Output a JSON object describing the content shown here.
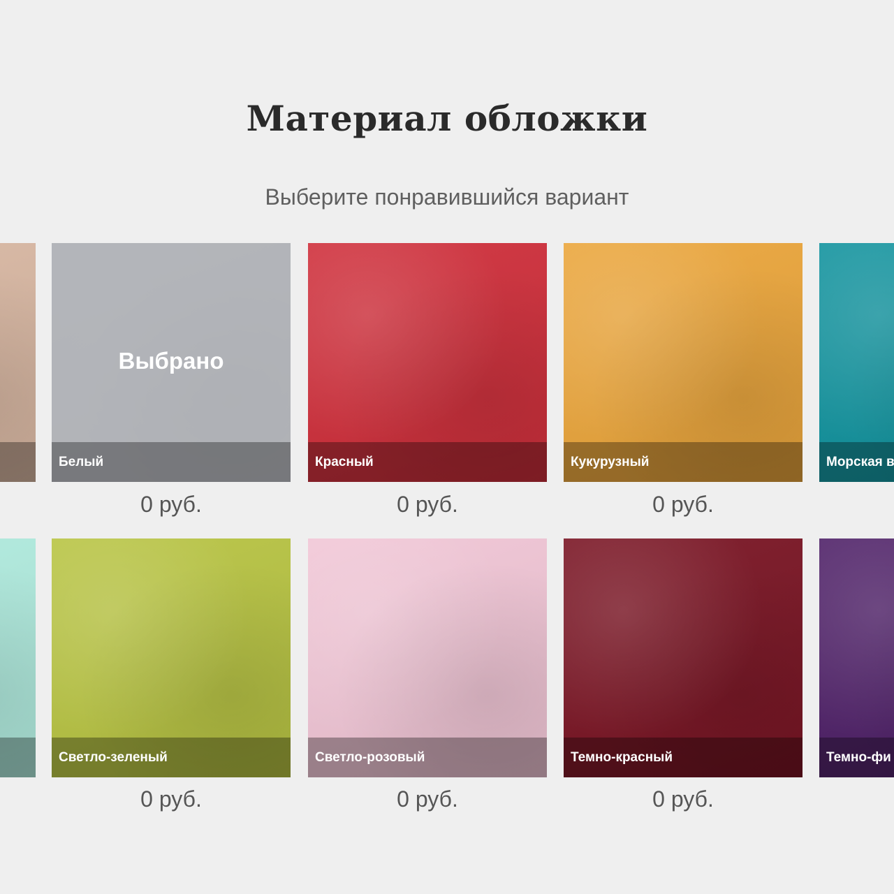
{
  "heading": {
    "title": "Материал обложки",
    "subtitle": "Выберите понравившийся вариант"
  },
  "selected_label": "Выбрано",
  "materials": [
    {
      "name": "",
      "price": "",
      "color": "#d9b8a3",
      "selected": false
    },
    {
      "name": "Белый",
      "price": "0 руб.",
      "color": "#f4f4f2",
      "selected": true
    },
    {
      "name": "Красный",
      "price": "0 руб.",
      "color": "#cf2f3b",
      "selected": false
    },
    {
      "name": "Кукурузный",
      "price": "0 руб.",
      "color": "#eba63c",
      "selected": false
    },
    {
      "name": "Морская в",
      "price": "",
      "color": "#12939e",
      "selected": false
    },
    {
      "name": "",
      "price": "",
      "color": "#b1ecdf",
      "selected": false
    },
    {
      "name": "Светло-зеленый",
      "price": "0 руб.",
      "color": "#b8c443",
      "selected": false
    },
    {
      "name": "Светло-розовый",
      "price": "0 руб.",
      "color": "#f1c6d6",
      "selected": false
    },
    {
      "name": "Темно-красный",
      "price": "0 руб.",
      "color": "#7a1524",
      "selected": false
    },
    {
      "name": "Темно-фи",
      "price": "",
      "color": "#4f2168",
      "selected": false
    }
  ]
}
